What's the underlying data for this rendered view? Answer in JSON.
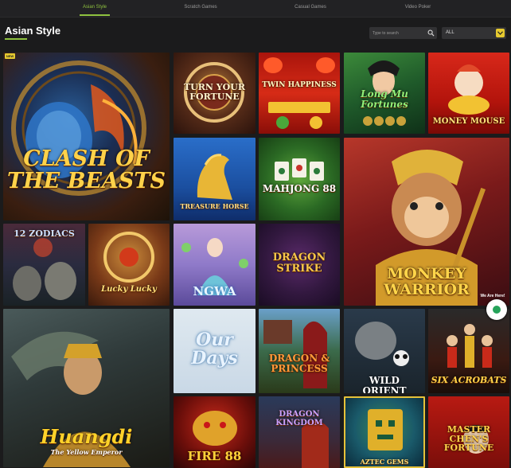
{
  "nav": {
    "tabs": [
      {
        "label": "Asian Style"
      },
      {
        "label": "Scratch Games"
      },
      {
        "label": "Casual Games"
      },
      {
        "label": "Video Poker"
      }
    ]
  },
  "page": {
    "title": "Asian Style"
  },
  "search": {
    "placeholder": "Type to search"
  },
  "filter": {
    "value": "ALL"
  },
  "badge": {
    "new": "NEW"
  },
  "chat": {
    "label": "We Are Here!"
  },
  "games": [
    {
      "label": "CLASH OF THE BEASTS"
    },
    {
      "label": "TURN YOUR FORTUNE"
    },
    {
      "label": "TWIN HAPPINESS"
    },
    {
      "label": "Long Mu Fortunes"
    },
    {
      "label": "MONEY MOUSE"
    },
    {
      "label": "TREASURE HORSE"
    },
    {
      "label": "MAHJONG 88"
    },
    {
      "label": "MONKEY WARRIOR"
    },
    {
      "label": "12 ZODIACS"
    },
    {
      "label": "Lucky Lucky"
    },
    {
      "label": "NGWA"
    },
    {
      "label": "DRAGON STRIKE"
    },
    {
      "label": "Huangdi"
    },
    {
      "label": "The Yellow Emperor"
    },
    {
      "label": "Our Days"
    },
    {
      "label": "DRAGON & PRINCESS"
    },
    {
      "label": "WILD ORIENT"
    },
    {
      "label": "SIX ACROBATS"
    },
    {
      "label": "FIRE 88"
    },
    {
      "label": "DRAGON KINGDOM"
    },
    {
      "label": "AZTEC GEMS"
    },
    {
      "label": "MASTER CHEN'S FORTUNE"
    }
  ]
}
